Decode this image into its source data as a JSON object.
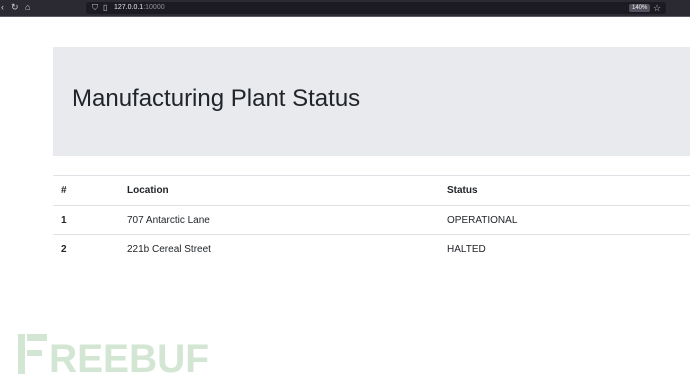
{
  "browser": {
    "url_host": "127.0.0.1",
    "url_port": ":10000",
    "zoom": "140%",
    "icons": [
      "back-icon",
      "reload-icon",
      "home-icon",
      "shield-icon",
      "page-icon",
      "star-icon"
    ]
  },
  "header": {
    "title": "Manufacturing Plant Status"
  },
  "table": {
    "headers": [
      "#",
      "Location",
      "Status"
    ],
    "rows": [
      {
        "num": "1",
        "location": "707 Antarctic Lane",
        "status": "OPERATIONAL"
      },
      {
        "num": "2",
        "location": "221b Cereal Street",
        "status": "HALTED"
      }
    ]
  },
  "watermark": {
    "text": "FREEBUF",
    "color": "#cfe3cf"
  },
  "colors": {
    "toolbar": "#2b2a33",
    "jumbotron": "#e8eaed",
    "text": "#212529",
    "border": "#dee2e6"
  }
}
